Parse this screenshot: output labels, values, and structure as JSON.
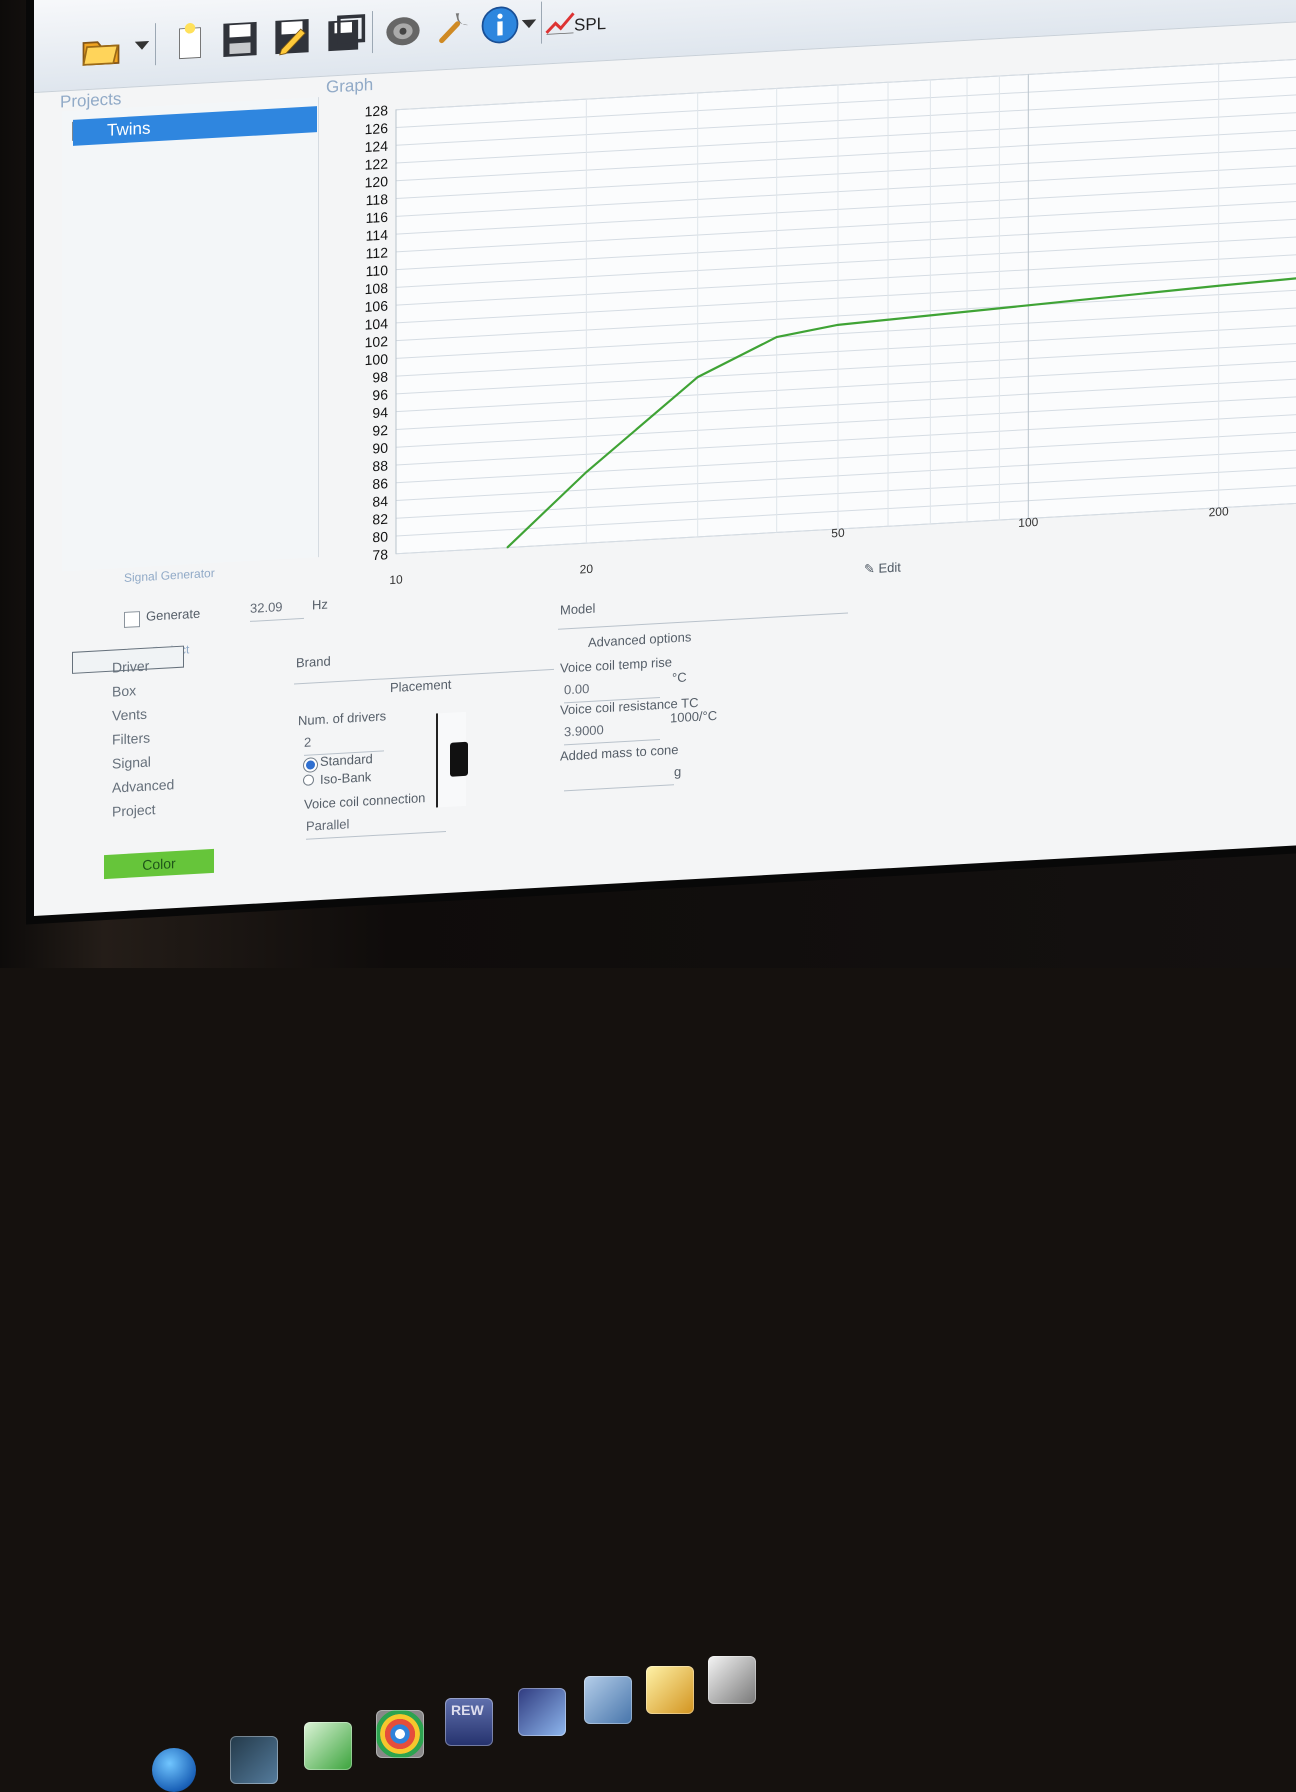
{
  "app": {
    "toolbar": {
      "spl_label": "SPL"
    },
    "sections": {
      "projects_title": "Projects",
      "graph_title": "Graph"
    },
    "project": {
      "name": "Twins",
      "checked": true
    }
  },
  "graph": {
    "y_labels": [
      "128",
      "126",
      "124",
      "122",
      "120",
      "118",
      "116",
      "114",
      "112",
      "110",
      "108",
      "106",
      "104",
      "102",
      "100",
      "98",
      "96",
      "94",
      "92",
      "90",
      "88",
      "86",
      "84",
      "82",
      "80",
      "78"
    ],
    "x_labels": [
      "10",
      "20",
      "50",
      "100",
      "200"
    ],
    "edit_label": "Edit",
    "series_color": "#3fa335"
  },
  "chart_data": {
    "type": "line",
    "x": [
      15,
      20,
      30,
      40,
      50,
      100,
      200,
      300
    ],
    "y": [
      78,
      86,
      96,
      100,
      101,
      102,
      103,
      103.5
    ],
    "xlabel": "",
    "ylabel": "",
    "ylim": [
      78,
      128
    ],
    "x_scale": "log",
    "grid": true
  },
  "signal_generator": {
    "title": "Signal Generator",
    "generate_label": "Generate",
    "frequency_value": "32.09",
    "unit": "Hz"
  },
  "project_panel": {
    "title": "Project",
    "nav": [
      "Driver",
      "Box",
      "Vents",
      "Filters",
      "Signal",
      "Advanced",
      "Project"
    ],
    "selected": "Driver",
    "brand_label": "Brand",
    "model_label": "Model",
    "placement_label": "Placement",
    "num_drivers_label": "Num. of drivers",
    "num_drivers_value": "2",
    "standard_label": "Standard",
    "iso_bank_label": "Iso-Bank",
    "voice_coil_connection_label": "Voice coil connection",
    "voice_coil_connection_value": "Parallel",
    "advanced_options_label": "Advanced options",
    "voice_coil_temp_rise_label": "Voice coil temp rise",
    "voice_coil_temp_rise_value": "0.00",
    "voice_coil_temp_rise_unit": "°C",
    "voice_coil_resistance_tc_label": "Voice coil resistance TC",
    "voice_coil_resistance_tc_value": "3.9000",
    "voice_coil_resistance_tc_unit": "1000/°C",
    "added_mass_label": "Added mass to cone",
    "added_mass_unit": "g",
    "color_label": "Color"
  },
  "taskbar": {
    "rew_label": "REW"
  }
}
